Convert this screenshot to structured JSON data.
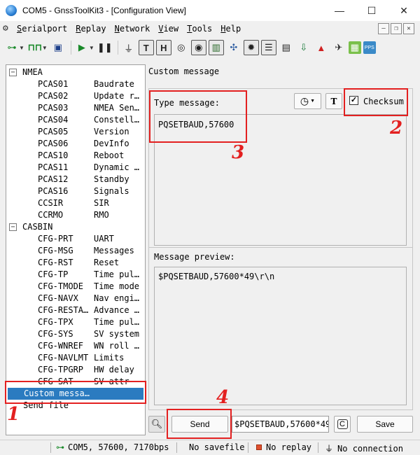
{
  "window": {
    "title": "COM5 - GnssToolKit3 - [Configuration View]",
    "controls": [
      "—",
      "☐",
      "✕"
    ]
  },
  "menu": {
    "items": [
      {
        "first": "S",
        "rest": "erialport"
      },
      {
        "first": "R",
        "rest": "eplay"
      },
      {
        "first": "N",
        "rest": "etwork"
      },
      {
        "first": "V",
        "rest": "iew"
      },
      {
        "first": "T",
        "rest": "ools"
      },
      {
        "first": "H",
        "rest": "elp"
      }
    ]
  },
  "toolbar": {
    "icons": [
      "connect-icon",
      "signal-icon",
      "save-icon",
      "play-icon",
      "pause-icon",
      "plug-icon",
      "text-view-icon",
      "hex-view-icon",
      "target-icon",
      "location-icon",
      "chart-icon",
      "satellite-icon",
      "settings-icon",
      "list-icon",
      "document-icon",
      "download-icon",
      "arrow-icon",
      "satellite-dish-icon",
      "map-icon",
      "pps-icon"
    ],
    "text_label": "T",
    "hex_label": "H",
    "pps_label": "PPS"
  },
  "tree": {
    "groups": [
      {
        "name": "NMEA",
        "items": [
          {
            "key": "PCAS01",
            "value": "Baudrate"
          },
          {
            "key": "PCAS02",
            "value": "Update r…"
          },
          {
            "key": "PCAS03",
            "value": "NMEA Sen…"
          },
          {
            "key": "PCAS04",
            "value": "Constell…"
          },
          {
            "key": "PCAS05",
            "value": "Version"
          },
          {
            "key": "PCAS06",
            "value": "DevInfo"
          },
          {
            "key": "PCAS10",
            "value": "Reboot"
          },
          {
            "key": "PCAS11",
            "value": "Dynamic …"
          },
          {
            "key": "PCAS12",
            "value": "Standby"
          },
          {
            "key": "PCAS16",
            "value": "Signals"
          },
          {
            "key": "CCSIR",
            "value": "SIR"
          },
          {
            "key": "CCRMO",
            "value": "RMO"
          }
        ]
      },
      {
        "name": "CASBIN",
        "items": [
          {
            "key": "CFG-PRT",
            "value": "UART"
          },
          {
            "key": "CFG-MSG",
            "value": "Messages"
          },
          {
            "key": "CFG-RST",
            "value": "Reset"
          },
          {
            "key": "CFG-TP",
            "value": "Time pul…"
          },
          {
            "key": "CFG-TMODE",
            "value": "Time mode"
          },
          {
            "key": "CFG-NAVX",
            "value": "Nav engi…"
          },
          {
            "key": "CFG-RESTA…",
            "value": "Advance …"
          },
          {
            "key": "CFG-TPX",
            "value": "Time pul…"
          },
          {
            "key": "CFG-SYS",
            "value": "SV system"
          },
          {
            "key": "CFG-WNREF",
            "value": "WN roll …"
          },
          {
            "key": "CFG-NAVLMT",
            "value": "Limits"
          },
          {
            "key": "CFG-TPGRP",
            "value": "HW delay"
          },
          {
            "key": "CFG-SAT",
            "value": "SV attr"
          }
        ]
      }
    ],
    "custom_message": "Custom messa…",
    "send_file": "Send file"
  },
  "panel": {
    "title": "Custom message",
    "type_label": "Type message:",
    "type_value": "PQSETBAUD,57600",
    "checksum_label": "Checksum",
    "checksum_checked": "✓",
    "text_button": "T",
    "preview_label": "Message preview:",
    "preview_value": "$PQSETBAUD,57600*49\\r\\n",
    "send_button": "Send",
    "history_value": "$PQSETBAUD,57600*49",
    "clear_button": "C",
    "save_button": "Save"
  },
  "annotations": [
    "1",
    "2",
    "3",
    "4"
  ],
  "status": {
    "port": "COM5, 57600, 7170bps",
    "savefile": "No savefile",
    "replay": "No replay",
    "connection": "No connection"
  },
  "colors": {
    "selection": "#2b7bc0",
    "annotation": "#e32020"
  }
}
